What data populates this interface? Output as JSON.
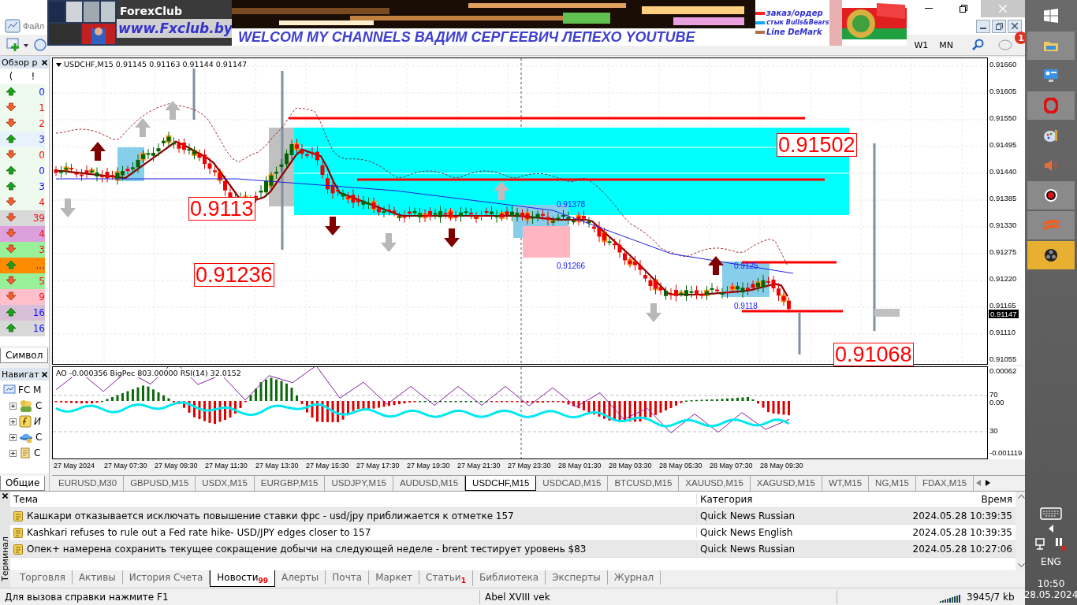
{
  "banner": {
    "logo": "ForexClub",
    "url": "www.Fxclub.by",
    "headline": "WELCOM MY CHANNELS ВАДИМ СЕРГЕЕВИЧ ЛЕПЕХО YOUTUBE",
    "legend": [
      {
        "label": "заказ/ордер",
        "color": "#ff2020"
      },
      {
        "label": "стык Bulls&Bears",
        "color": "#10a8f0"
      },
      {
        "label": "Line DeMark",
        "color": "#b0704a"
      }
    ]
  },
  "menu": [
    "Файл"
  ],
  "toolbar": {
    "periods": [
      "W1",
      "MN"
    ],
    "notification_count": "1"
  },
  "market_watch": {
    "title": "Обзор р",
    "columns": [
      "(",
      "!"
    ],
    "tab": "Символ",
    "rows": [
      {
        "kind": "up",
        "value": "0",
        "color": "#eefaee"
      },
      {
        "kind": "down",
        "value": "1",
        "color": "#eefaee"
      },
      {
        "kind": "down",
        "value": "2",
        "color": "#eefaee"
      },
      {
        "kind": "up",
        "value": "3",
        "color": "#e8f2fc"
      },
      {
        "kind": "down",
        "value": "0",
        "color": "#eefaee"
      },
      {
        "kind": "up",
        "value": "0",
        "color": "#eefaee"
      },
      {
        "kind": "up",
        "value": "3",
        "color": "#eefaee"
      },
      {
        "kind": "down",
        "value": "4",
        "color": "#eefaee"
      },
      {
        "kind": "down",
        "value": "39",
        "color": "#d8d8d8"
      },
      {
        "kind": "down",
        "value": "4",
        "color": "#dca0dc"
      },
      {
        "kind": "down",
        "value": "3",
        "color": "#98f098"
      },
      {
        "kind": "up",
        "value": "...",
        "color": "#ff8c00"
      },
      {
        "kind": "down",
        "value": "5",
        "color": "#98f098"
      },
      {
        "kind": "down",
        "value": "9",
        "color": "#ffc0cb"
      },
      {
        "kind": "up",
        "value": "16",
        "color": "#d8bfd8"
      },
      {
        "kind": "up",
        "value": "16",
        "color": "#d8d8d8"
      }
    ]
  },
  "navigator": {
    "title": "Навигат",
    "root": "FC M",
    "tab": "Общие",
    "children": [
      {
        "kind": "accounts",
        "label": "С"
      },
      {
        "kind": "indicators",
        "label": "И"
      },
      {
        "kind": "experts",
        "label": "С"
      },
      {
        "kind": "scripts",
        "label": "С"
      }
    ]
  },
  "chart": {
    "header": "USDCHF,M15  0.91145 0.91163 0.91144 0.91147",
    "price_ticks": [
      "0.91660",
      "0.91605",
      "0.91550",
      "0.91495",
      "0.91440",
      "0.91385",
      "0.91330",
      "0.91275",
      "0.91220",
      "0.91165",
      "0.91110",
      "0.91055"
    ],
    "current_price": "0.91147",
    "big_labels": [
      "0.91502",
      "0.9113",
      "0.91236",
      "0.91068"
    ],
    "small_labels": [
      "0.91378",
      "0.91266",
      "0.9125",
      "0.9118"
    ],
    "indicator": {
      "header": "AO -0.000356  BigPec 803.00000  RSI(14) 32.0152",
      "ticks": [
        "0.00062",
        "70",
        "0.00",
        "30",
        "-0.001119"
      ]
    },
    "time_labels": [
      "27 May 2024",
      "27 May 07:30",
      "27 May 09:30",
      "27 May 11:30",
      "27 May 13:30",
      "27 May 15:30",
      "27 May 17:30",
      "27 May 19:30",
      "27 May 21:30",
      "27 May 23:30",
      "28 May 01:30",
      "28 May 03:30",
      "28 May 05:30",
      "28 May 07:30",
      "28 May 09:30"
    ]
  },
  "chart_tabs": [
    {
      "label": "EURUSD,M30",
      "selected": false
    },
    {
      "label": "GBPUSD,M15",
      "selected": false
    },
    {
      "label": "USDX,M15",
      "selected": false
    },
    {
      "label": "EURGBP,M15",
      "selected": false
    },
    {
      "label": "USDJPY,M15",
      "selected": false
    },
    {
      "label": "AUDUSD,M15",
      "selected": false
    },
    {
      "label": "USDCHF,M15",
      "selected": true
    },
    {
      "label": "USDCAD,M15",
      "selected": false
    },
    {
      "label": "BTCUSD,M15",
      "selected": false
    },
    {
      "label": "XAUUSD,M15",
      "selected": false
    },
    {
      "label": "XAGUSD,M15",
      "selected": false
    },
    {
      "label": "WT,M15",
      "selected": false
    },
    {
      "label": "NG,M15",
      "selected": false
    },
    {
      "label": "FDAX,M15",
      "selected": false
    }
  ],
  "terminal": {
    "title": "Терминал",
    "columns": [
      "Тема",
      "Категория",
      "Время"
    ],
    "rows": [
      {
        "subject": "Кашкари отказывается исключать повышение ставки фрс - usd/jpy приближается к отметке 157",
        "category": "Quick News Russian",
        "time": "2024.05.28 10:39:35"
      },
      {
        "subject": "Kashkari refuses to rule out a Fed rate hike- USD/JPY edges closer to 157",
        "category": "Quick News English",
        "time": "2024.05.28 10:39:35"
      },
      {
        "subject": "Опек+ намерена сохранить текущее сокращение добычи на следующей неделе - brent тестирует уровень $83",
        "category": "Quick News Russian",
        "time": "2024.05.28 10:27:06"
      }
    ],
    "tabs": [
      {
        "label": "Торговля",
        "selected": false
      },
      {
        "label": "Активы",
        "selected": false
      },
      {
        "label": "История Счета",
        "selected": false
      },
      {
        "label": "Новости",
        "badge": "99",
        "selected": true
      },
      {
        "label": "Алерты",
        "selected": false
      },
      {
        "label": "Почта",
        "selected": false
      },
      {
        "label": "Маркет",
        "selected": false
      },
      {
        "label": "Статьи",
        "badge": "1",
        "selected": false
      },
      {
        "label": "Библиотека",
        "selected": false
      },
      {
        "label": "Эксперты",
        "selected": false
      },
      {
        "label": "Журнал",
        "selected": false
      }
    ]
  },
  "status_bar": {
    "help": "Для вызова справки нажмите F1",
    "profile": "Abel XVIII vek",
    "traffic": "3945/7 kb"
  },
  "taskbar": {
    "language": "ENG",
    "time": "10:50",
    "date": "28.05.2024"
  }
}
